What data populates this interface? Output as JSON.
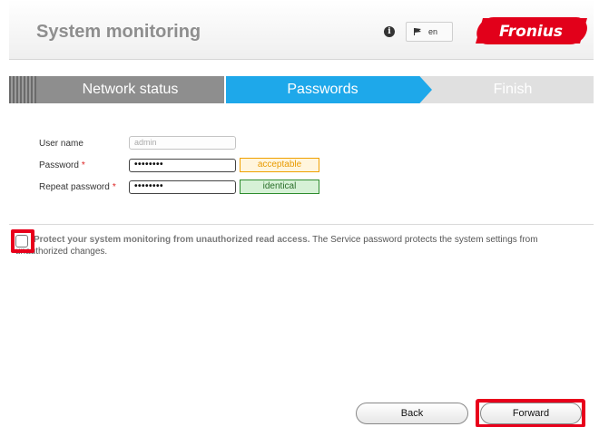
{
  "header": {
    "title": "System monitoring",
    "info_icon": "i",
    "language": "en",
    "logo_text": "Fronius",
    "brand_color": "#e2001a"
  },
  "steps": [
    {
      "label": "Network status",
      "state": "completed"
    },
    {
      "label": "Passwords",
      "state": "active"
    },
    {
      "label": "Finish",
      "state": "pending"
    }
  ],
  "form": {
    "username_label": "User name",
    "username_placeholder": "admin",
    "password_label": "Password",
    "password_value": "••••••••",
    "password_status": "acceptable",
    "repeat_label": "Repeat password",
    "repeat_value": "••••••••",
    "repeat_status": "identical",
    "required_marker": "*"
  },
  "protect": {
    "checked": false,
    "bold_text": "Protect your system monitoring from unauthorized read access.",
    "rest_text": " The Service password protects the system settings from unauthorized changes."
  },
  "buttons": {
    "back": "Back",
    "forward": "Forward"
  },
  "colors": {
    "active_step": "#1ea8ea",
    "completed_step": "#8e8e8e",
    "highlight": "#e8001b",
    "acceptable": "#f0a000",
    "identical": "#2e8b2e"
  }
}
